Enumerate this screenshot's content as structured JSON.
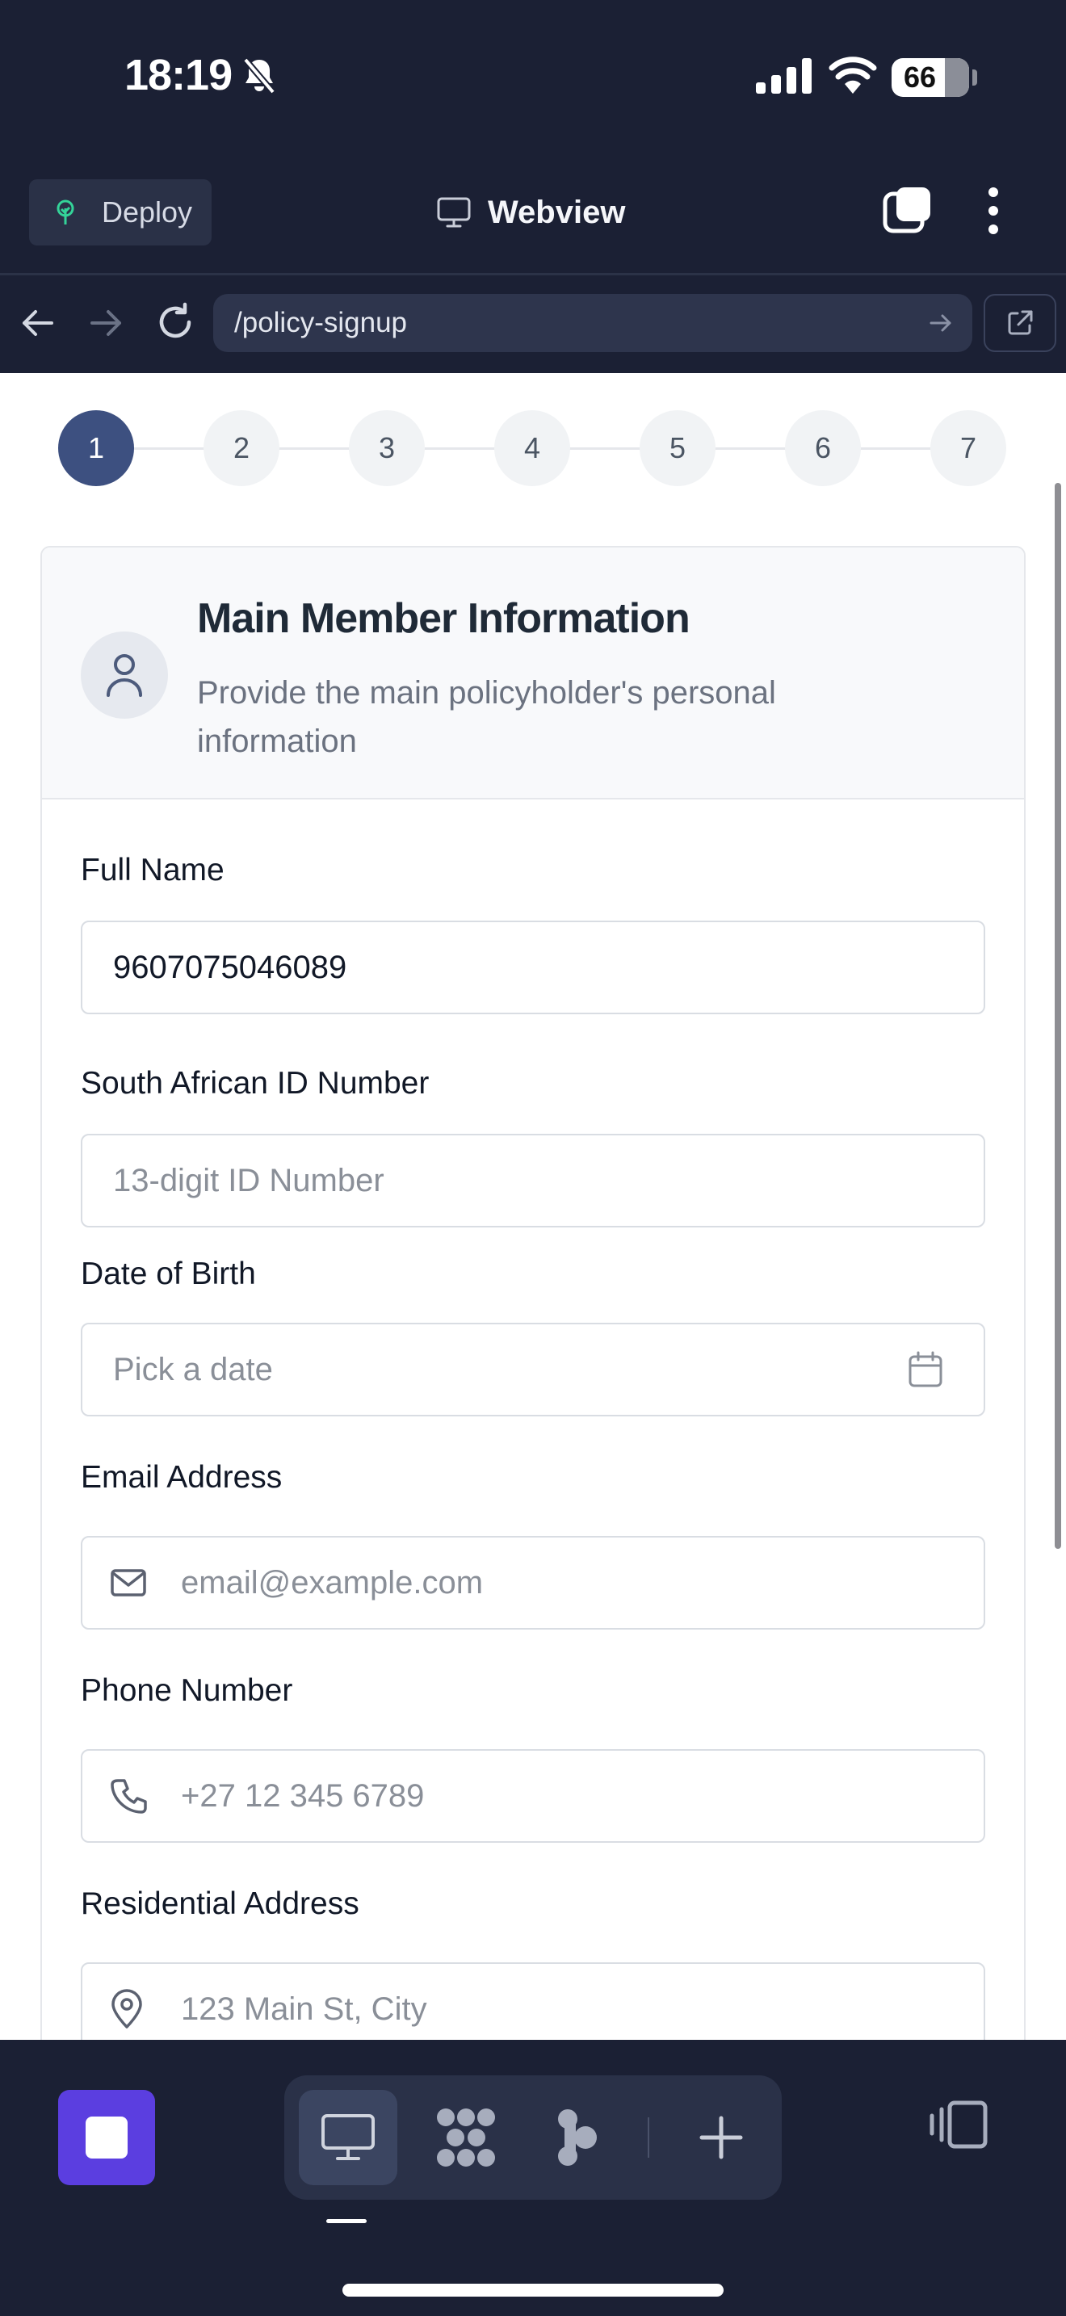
{
  "status_bar": {
    "time": "18:19",
    "battery": "66"
  },
  "header": {
    "deploy_label": "Deploy",
    "title": "Webview"
  },
  "url_bar": {
    "path": "/policy-signup"
  },
  "stepper": {
    "steps": [
      "1",
      "2",
      "3",
      "4",
      "5",
      "6",
      "7"
    ],
    "active_step": 1
  },
  "card": {
    "title": "Main Member Information",
    "subtitle": "Provide the main policyholder's personal information"
  },
  "fields": {
    "full_name": {
      "label": "Full Name",
      "value": "9607075046089"
    },
    "id_number": {
      "label": "South African ID Number",
      "placeholder": "13-digit ID Number"
    },
    "dob": {
      "label": "Date of Birth",
      "placeholder": "Pick a date"
    },
    "email": {
      "label": "Email Address",
      "placeholder": "email@example.com"
    },
    "phone": {
      "label": "Phone Number",
      "placeholder": "+27 12 345 6789"
    },
    "address": {
      "label": "Residential Address",
      "placeholder": "123 Main St, City"
    }
  },
  "icons": {
    "status": [
      "bell-slash-icon",
      "signal-icon",
      "wifi-icon"
    ],
    "header": [
      "tree-icon",
      "monitor-icon",
      "tabs-icon",
      "more-vertical-icon"
    ],
    "url": [
      "arrow-left-icon",
      "arrow-right-icon",
      "reload-icon",
      "arrow-right-small-icon",
      "external-link-icon"
    ],
    "form": [
      "user-icon",
      "calendar-icon",
      "mail-icon",
      "phone-icon",
      "map-pin-icon"
    ],
    "toolbar": [
      "stop-icon",
      "desktop-icon",
      "grid-icon",
      "flow-icon",
      "plus-icon",
      "panel-toggle-icon"
    ]
  },
  "colors": {
    "chrome_bg": "#1b2034",
    "url_field_bg": "#2e354d",
    "active_step": "#3d5080",
    "accent_purple": "#5b3ee0",
    "deploy_icon": "#34d399"
  }
}
